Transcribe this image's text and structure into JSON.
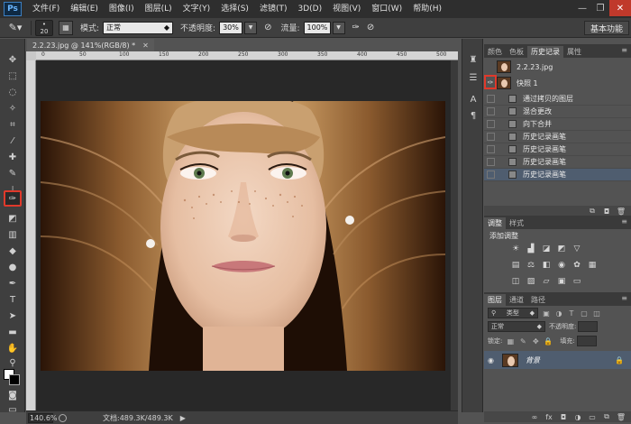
{
  "app": {
    "logo": "Ps"
  },
  "menus": [
    "文件(F)",
    "编辑(E)",
    "图像(I)",
    "图层(L)",
    "文字(Y)",
    "选择(S)",
    "滤镜(T)",
    "3D(D)",
    "视图(V)",
    "窗口(W)",
    "帮助(H)"
  ],
  "window_controls": {
    "minimize": "—",
    "restore": "❐",
    "close": "✕"
  },
  "options_bar": {
    "brush_size": "20",
    "mode_label": "模式:",
    "mode_value": "正常",
    "opacity_label": "不透明度:",
    "opacity_value": "30%",
    "flow_label": "流量:",
    "flow_value": "100%",
    "workspace": "基本功能"
  },
  "document": {
    "tab_title": "2.2.23.jpg @ 141%(RGB/8) *",
    "ruler_ticks": [
      "0",
      "50",
      "100",
      "150",
      "200",
      "250",
      "300",
      "350",
      "400",
      "450",
      "500"
    ]
  },
  "status_bar": {
    "zoom": "140.6%",
    "doc_info": "文档:489.3K/489.3K"
  },
  "history_panel": {
    "tabs": [
      "颜色",
      "色板",
      "历史记录",
      "属性"
    ],
    "active_tab": "历史记录",
    "snapshot_file": "2.2.23.jpg",
    "snapshot_1": "快照 1",
    "items": [
      "通过拷贝的图层",
      "混合更改",
      "向下合并",
      "历史记录画笔",
      "历史记录画笔",
      "历史记录画笔",
      "历史记录画笔"
    ]
  },
  "adjustments_panel": {
    "tabs": [
      "调整",
      "样式"
    ],
    "title": "添加调整"
  },
  "layers_panel": {
    "tabs": [
      "图层",
      "通道",
      "路径"
    ],
    "filter_label": "类型",
    "blend_mode": "正常",
    "opacity_label": "不透明度:",
    "lock_label": "锁定:",
    "fill_label": "填充:",
    "layer_name": "背景"
  },
  "colors": {
    "accent_red": "#e0392b",
    "selection_blue": "#4f5d6f",
    "chrome_dark": "#3f3f3f"
  }
}
